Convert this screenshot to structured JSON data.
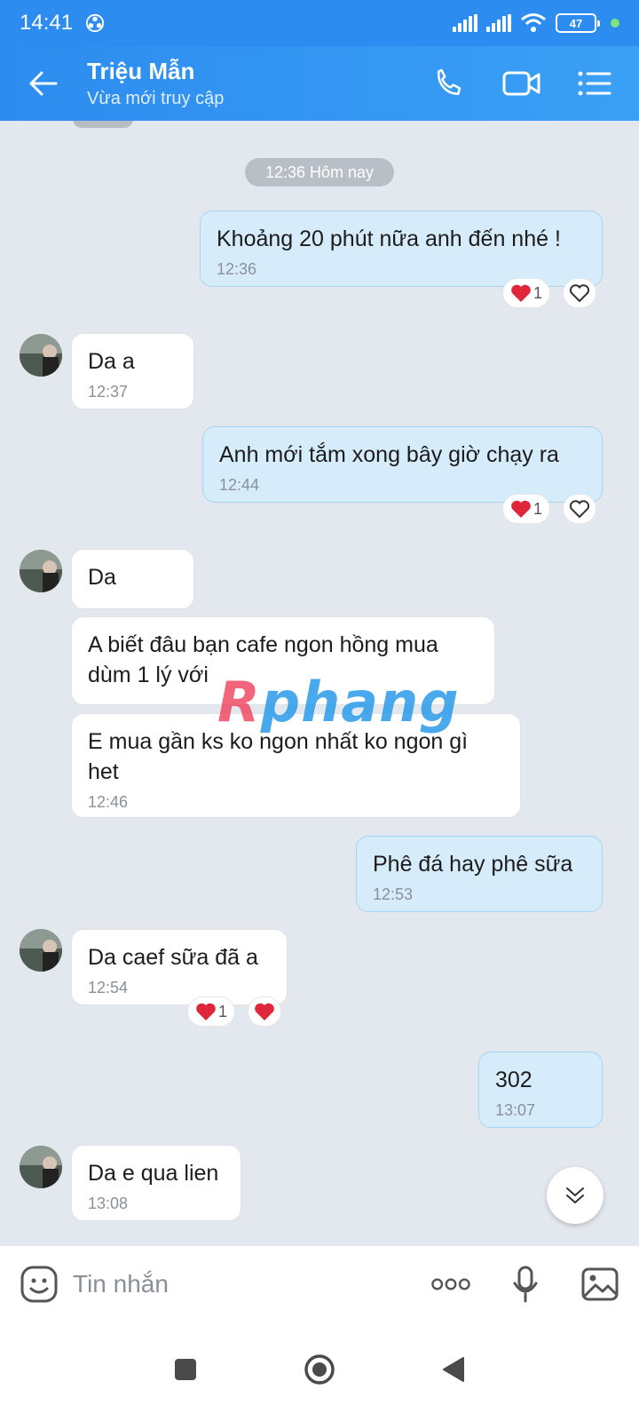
{
  "status_bar": {
    "time": "14:41",
    "battery": "47"
  },
  "header": {
    "name": "Triệu Mẫn",
    "status": "Vừa mới truy cập"
  },
  "chat": {
    "divider": "12:36 Hôm nay",
    "messages": [
      {
        "dir": "out",
        "text": "Khoảng 20 phút nữa anh đến nhé !",
        "time": "12:36",
        "reaction_count": "1"
      },
      {
        "dir": "in",
        "text": "Da a",
        "time": "12:37"
      },
      {
        "dir": "out",
        "text": "Anh mới tắm xong bây giờ chạy ra",
        "time": "12:44",
        "reaction_count": "1"
      },
      {
        "dir": "in",
        "text": "Da"
      },
      {
        "dir": "in",
        "text": "A biết đâu bạn cafe ngon hồng mua dùm 1 lý với"
      },
      {
        "dir": "in",
        "text": "E mua gần ks ko ngon nhất ko ngon gì het",
        "time": "12:46"
      },
      {
        "dir": "out",
        "text": "Phê đá hay phê sữa",
        "time": "12:53"
      },
      {
        "dir": "in",
        "text": "Da caef sữa đã a",
        "time": "12:54",
        "reaction_count": "1"
      },
      {
        "dir": "out",
        "text": "302",
        "time": "13:07"
      },
      {
        "dir": "in",
        "text": "Da e qua lien",
        "time": "13:08"
      }
    ]
  },
  "watermark": {
    "part1": "R",
    "part2": "phang"
  },
  "composer": {
    "placeholder": "Tin nhắn"
  },
  "colors": {
    "accent": "#2d8cf0",
    "bubble_out": "#d7ecfb",
    "heart": "#e0263a"
  }
}
